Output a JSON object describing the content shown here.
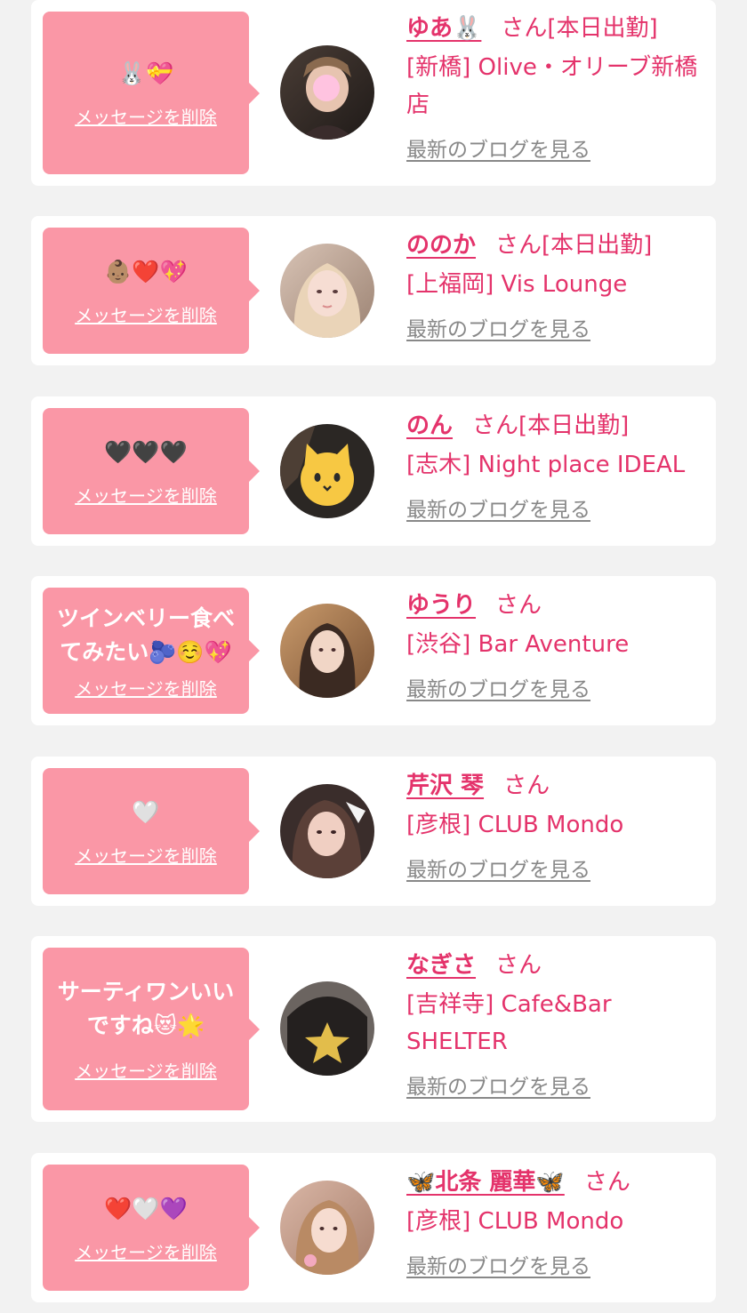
{
  "delete_label": "メッセージを削除",
  "blog_label": "最新のブログを見る",
  "colors": {
    "accent": "#e4336b",
    "bubble": "#fa97a6",
    "background": "#f2f2f2",
    "muted": "#888888"
  },
  "items": [
    {
      "message": "🐰💝",
      "name": "ゆあ🐰",
      "suffix": "さん[本日出勤]",
      "shop": "[新橋] Olive・オリーブ新橋店"
    },
    {
      "message": "👶🏽❤️💖",
      "name": "ののか",
      "suffix": "さん[本日出勤]",
      "shop": "[上福岡] Vis Lounge"
    },
    {
      "message": "🖤🖤🖤",
      "name": "のん",
      "suffix": "さん[本日出勤]",
      "shop": "[志木] Night place IDEAL"
    },
    {
      "message": "ツインベリー食べてみたい🫐☺️💖",
      "name": "ゆうり",
      "suffix": "さん",
      "shop": "[渋谷] Bar Aventure"
    },
    {
      "message": "🤍",
      "name": "芹沢 琴",
      "suffix": "さん",
      "shop": "[彦根] CLUB Mondo"
    },
    {
      "message": "サーティワンいいですね😻🌟",
      "name": "なぎさ",
      "suffix": "さん",
      "shop": "[吉祥寺] Cafe&Bar SHELTER"
    },
    {
      "message": "❤️🤍💜",
      "name": "🦋北条 麗華🦋",
      "suffix": "さん",
      "shop": "[彦根] CLUB Mondo"
    }
  ]
}
